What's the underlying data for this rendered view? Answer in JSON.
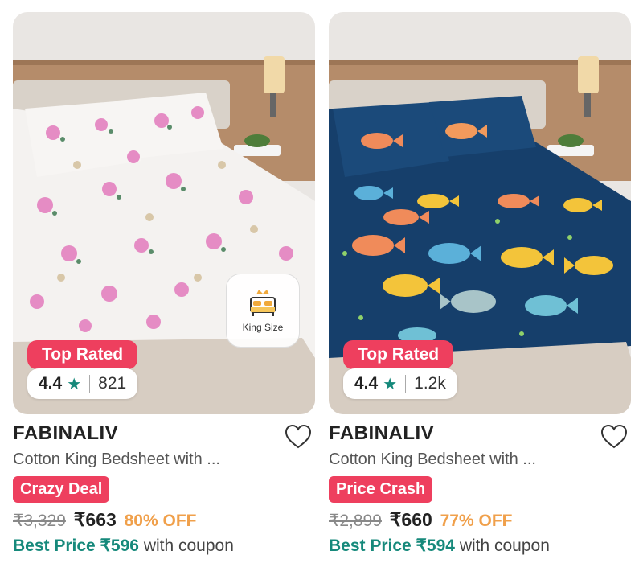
{
  "products": [
    {
      "image_alt": "floral bedsheet",
      "badge": "Top Rated",
      "rating": "4.4",
      "star_icon": "star-icon",
      "rating_count": "821",
      "size_tag": "King Size",
      "brand": "FABINALIV",
      "title": "Cotton King Bedsheet with ...",
      "deal": "Crazy Deal",
      "mrp": "₹3,329",
      "price": "₹663",
      "discount": "80% OFF",
      "best_price_label": "Best Price ₹596",
      "best_price_suffix": "with coupon"
    },
    {
      "image_alt": "fish print bedsheet",
      "badge": "Top Rated",
      "rating": "4.4",
      "star_icon": "star-icon",
      "rating_count": "1.2k",
      "size_tag": "",
      "brand": "FABINALIV",
      "title": "Cotton King Bedsheet with ...",
      "deal": "Price Crash",
      "mrp": "₹2,899",
      "price": "₹660",
      "discount": "77% OFF",
      "best_price_label": "Best Price ₹594",
      "best_price_suffix": "with coupon"
    }
  ],
  "colors": {
    "accent_pink": "#ee3f5e",
    "teal": "#16897b",
    "discount_orange": "#f0a04b"
  }
}
